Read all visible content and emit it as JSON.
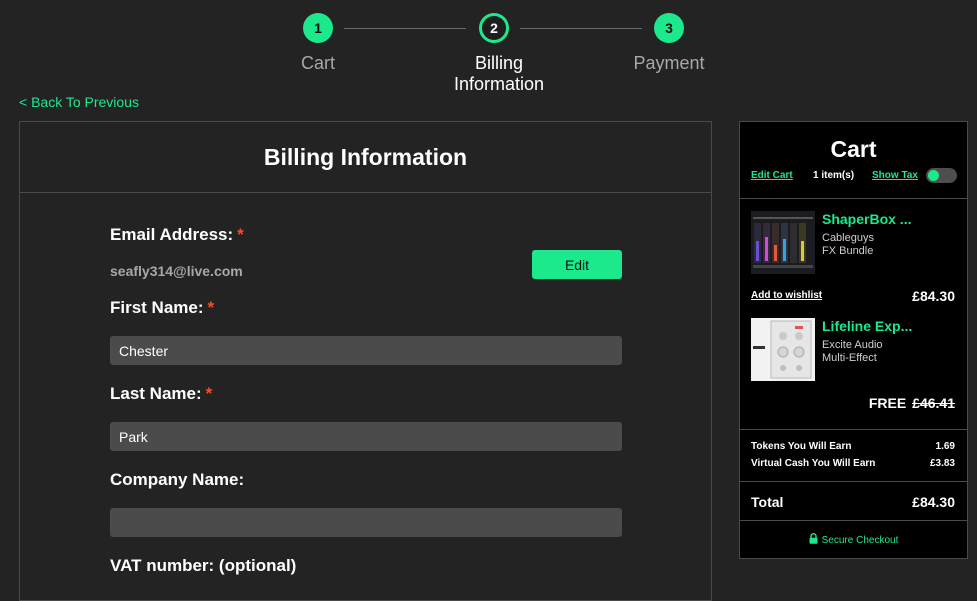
{
  "stepper": {
    "steps": [
      {
        "number": "1",
        "label": "Cart"
      },
      {
        "number": "2",
        "label": "Billing\nInformation"
      },
      {
        "number": "3",
        "label": "Payment"
      }
    ]
  },
  "back_link": "< Back To Previous",
  "billing": {
    "title": "Billing Information",
    "email_label": "Email Address:",
    "email_value": "seafly314@live.com",
    "edit_label": "Edit",
    "first_name_label": "First Name:",
    "first_name_value": "Chester",
    "last_name_label": "Last Name:",
    "last_name_value": "Park",
    "company_label": "Company Name:",
    "company_value": "",
    "vat_label": "VAT number: (optional)",
    "required_mark": "*"
  },
  "cart": {
    "title": "Cart",
    "edit_label": "Edit Cart",
    "item_count": "1 item(s)",
    "show_tax_label": "Show Tax",
    "items": [
      {
        "title": "ShaperBox ...",
        "brand": "Cableguys",
        "type": "FX Bundle",
        "price": "£84.30",
        "wishlist": "Add to wishlist"
      },
      {
        "title": "Lifeline Exp...",
        "brand": "Excite Audio",
        "type": "Multi-Effect",
        "price": "FREE",
        "old_price": "£46.41"
      }
    ],
    "tokens_label": "Tokens You Will Earn",
    "tokens_value": "1.69",
    "cash_label": "Virtual Cash You Will Earn",
    "cash_value": "£3.83",
    "total_label": "Total",
    "total_value": "£84.30",
    "secure_label": "Secure Checkout"
  },
  "colors": {
    "accent": "#1ce88c",
    "required": "#ff4a2d",
    "background": "#232323"
  }
}
